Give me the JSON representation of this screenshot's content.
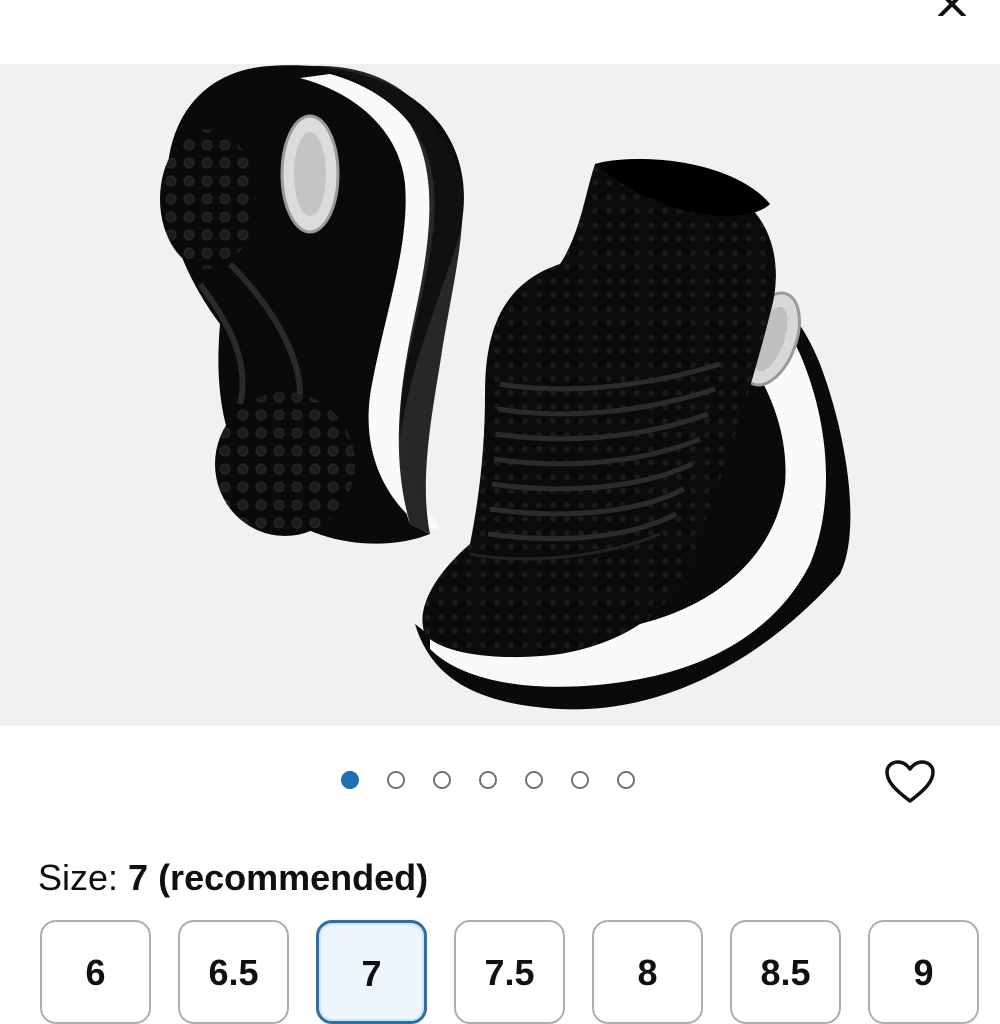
{
  "top_bar": {
    "close_icon": "close-icon"
  },
  "product_image": {
    "alt": "Black slip-on knit sneakers with white air-cushion sole",
    "background": "#f1f1f1"
  },
  "carousel": {
    "total_pages": 7,
    "active_index": 0,
    "active_color": "#1f6fb5"
  },
  "wishlist": {
    "icon": "heart-icon"
  },
  "size_selector": {
    "label": "Size: ",
    "value": "7 (recommended)",
    "options": [
      "6",
      "6.5",
      "7",
      "7.5",
      "8",
      "8.5",
      "9"
    ],
    "selected": "7",
    "selected_color": "#2b6fa8"
  }
}
